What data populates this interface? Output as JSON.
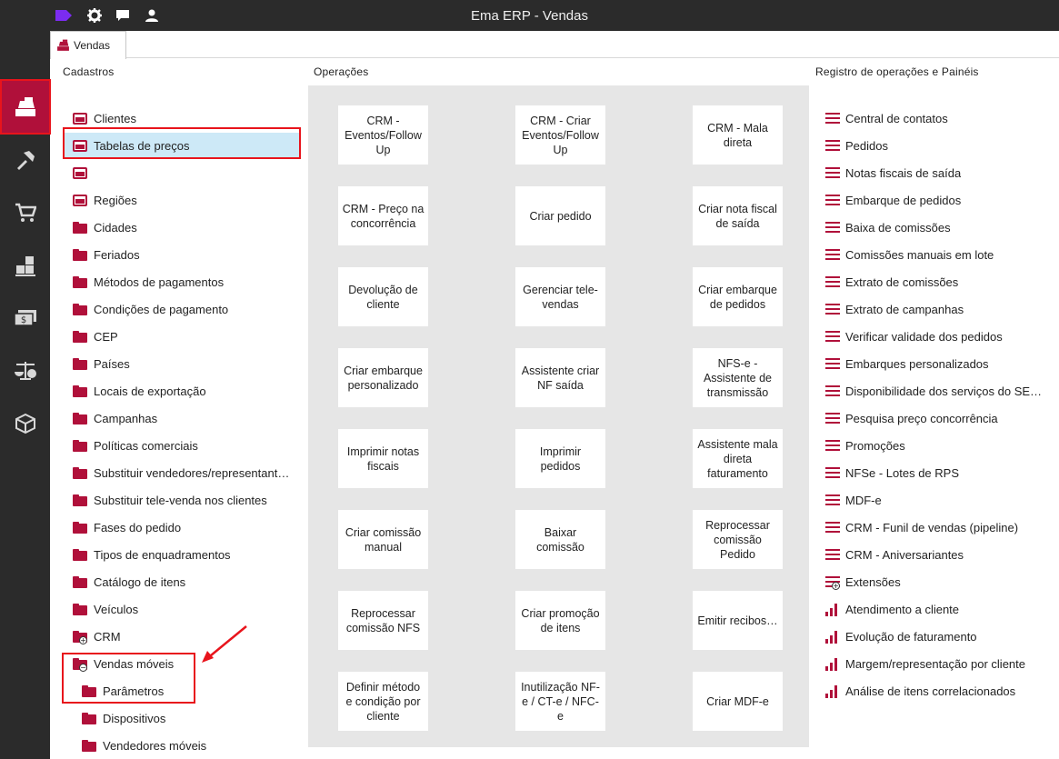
{
  "app": {
    "title": "Ema ERP - Vendas"
  },
  "topbar_icons": [
    "tag-icon",
    "gear-icon",
    "chat-icon",
    "user-icon"
  ],
  "rail_icons": [
    "register-icon",
    "tools-icon",
    "cart-icon",
    "warehouse-icon",
    "money-icon",
    "scales-icon",
    "box-icon"
  ],
  "tab": {
    "label": "Vendas"
  },
  "headers": {
    "cadastros": "Cadastros",
    "operacoes": "Operações",
    "registro": "Registro de operações e Painéis"
  },
  "cadastros": [
    {
      "label": "Clientes",
      "icon": "drawer"
    },
    {
      "label": "Tabelas de preços",
      "icon": "drawer"
    },
    {
      "label": "",
      "icon": "drawer"
    },
    {
      "label": "Regiões",
      "icon": "drawer"
    },
    {
      "label": "Cidades",
      "icon": "folder"
    },
    {
      "label": "Feriados",
      "icon": "folder"
    },
    {
      "label": "Métodos de pagamentos",
      "icon": "folder"
    },
    {
      "label": "Condições de pagamento",
      "icon": "folder"
    },
    {
      "label": "CEP",
      "icon": "folder"
    },
    {
      "label": "Países",
      "icon": "folder"
    },
    {
      "label": "Locais de exportação",
      "icon": "folder"
    },
    {
      "label": "Campanhas",
      "icon": "folder"
    },
    {
      "label": "Políticas comerciais",
      "icon": "folder"
    },
    {
      "label": "Substituir vendedores/representant…",
      "icon": "folder"
    },
    {
      "label": "Substituir tele-venda nos clientes",
      "icon": "folder"
    },
    {
      "label": "Fases do pedido",
      "icon": "folder"
    },
    {
      "label": "Tipos de enquadramentos",
      "icon": "folder"
    },
    {
      "label": "Catálogo de itens",
      "icon": "folder"
    },
    {
      "label": "Veículos",
      "icon": "folder"
    },
    {
      "label": "CRM",
      "icon": "folder-plus"
    },
    {
      "label": "Vendas móveis",
      "icon": "folder-minus"
    },
    {
      "label": "Parâmetros",
      "icon": "folder"
    },
    {
      "label": "Dispositivos",
      "icon": "folder"
    },
    {
      "label": "Vendedores móveis",
      "icon": "folder"
    }
  ],
  "operacoes": [
    [
      "CRM - Eventos/Follow Up",
      "CRM - Criar Eventos/Follow Up",
      "CRM - Mala direta"
    ],
    [
      "CRM - Preço na concorrência",
      "Criar pedido",
      "Criar nota fiscal de saída"
    ],
    [
      "Devolução de cliente",
      "Gerenciar tele-vendas",
      "Criar embarque de pedidos"
    ],
    [
      "Criar embarque personalizado",
      "Assistente criar NF saída",
      "NFS-e - Assistente de transmissão"
    ],
    [
      "Imprimir notas fiscais",
      "Imprimir pedidos",
      "Assistente mala direta faturamento"
    ],
    [
      "Criar comissão manual",
      "Baixar comissão",
      "Reprocessar comissão Pedido"
    ],
    [
      "Reprocessar comissão NFS",
      "Criar promoção de itens",
      "Emitir recibos…"
    ],
    [
      "Definir método e condição por cliente",
      "Inutilização NF-e / CT-e / NFC-e",
      "Criar MDF-e"
    ]
  ],
  "registro": [
    {
      "label": "Central de contatos",
      "icon": "list"
    },
    {
      "label": "Pedidos",
      "icon": "list"
    },
    {
      "label": "Notas fiscais de saída",
      "icon": "list"
    },
    {
      "label": "Embarque de pedidos",
      "icon": "list"
    },
    {
      "label": "Baixa de comissões",
      "icon": "list"
    },
    {
      "label": "Comissões manuais em lote",
      "icon": "list"
    },
    {
      "label": "Extrato de comissões",
      "icon": "list"
    },
    {
      "label": "Extrato de campanhas",
      "icon": "list"
    },
    {
      "label": "Verificar validade dos pedidos",
      "icon": "list"
    },
    {
      "label": "Embarques personalizados",
      "icon": "list"
    },
    {
      "label": "Disponibilidade dos serviços do SE…",
      "icon": "list"
    },
    {
      "label": "Pesquisa preço concorrência",
      "icon": "list"
    },
    {
      "label": "Promoções",
      "icon": "list"
    },
    {
      "label": "NFSe - Lotes de RPS",
      "icon": "list"
    },
    {
      "label": "MDF-e",
      "icon": "list"
    },
    {
      "label": "CRM - Funil de vendas (pipeline)",
      "icon": "list"
    },
    {
      "label": "CRM - Aniversariantes",
      "icon": "list"
    },
    {
      "label": "Extensões",
      "icon": "list-plus"
    },
    {
      "label": "Atendimento a cliente",
      "icon": "bars"
    },
    {
      "label": "Evolução de faturamento",
      "icon": "bars"
    },
    {
      "label": "Margem/representação por cliente",
      "icon": "bars"
    },
    {
      "label": "Análise de itens correlacionados",
      "icon": "bars"
    }
  ],
  "colors": {
    "accent": "#b0103a",
    "highlight": "#e8141c",
    "selection": "#cde9f7",
    "dark": "#2b2b2b",
    "brand_tag": "#7b2cf0"
  }
}
